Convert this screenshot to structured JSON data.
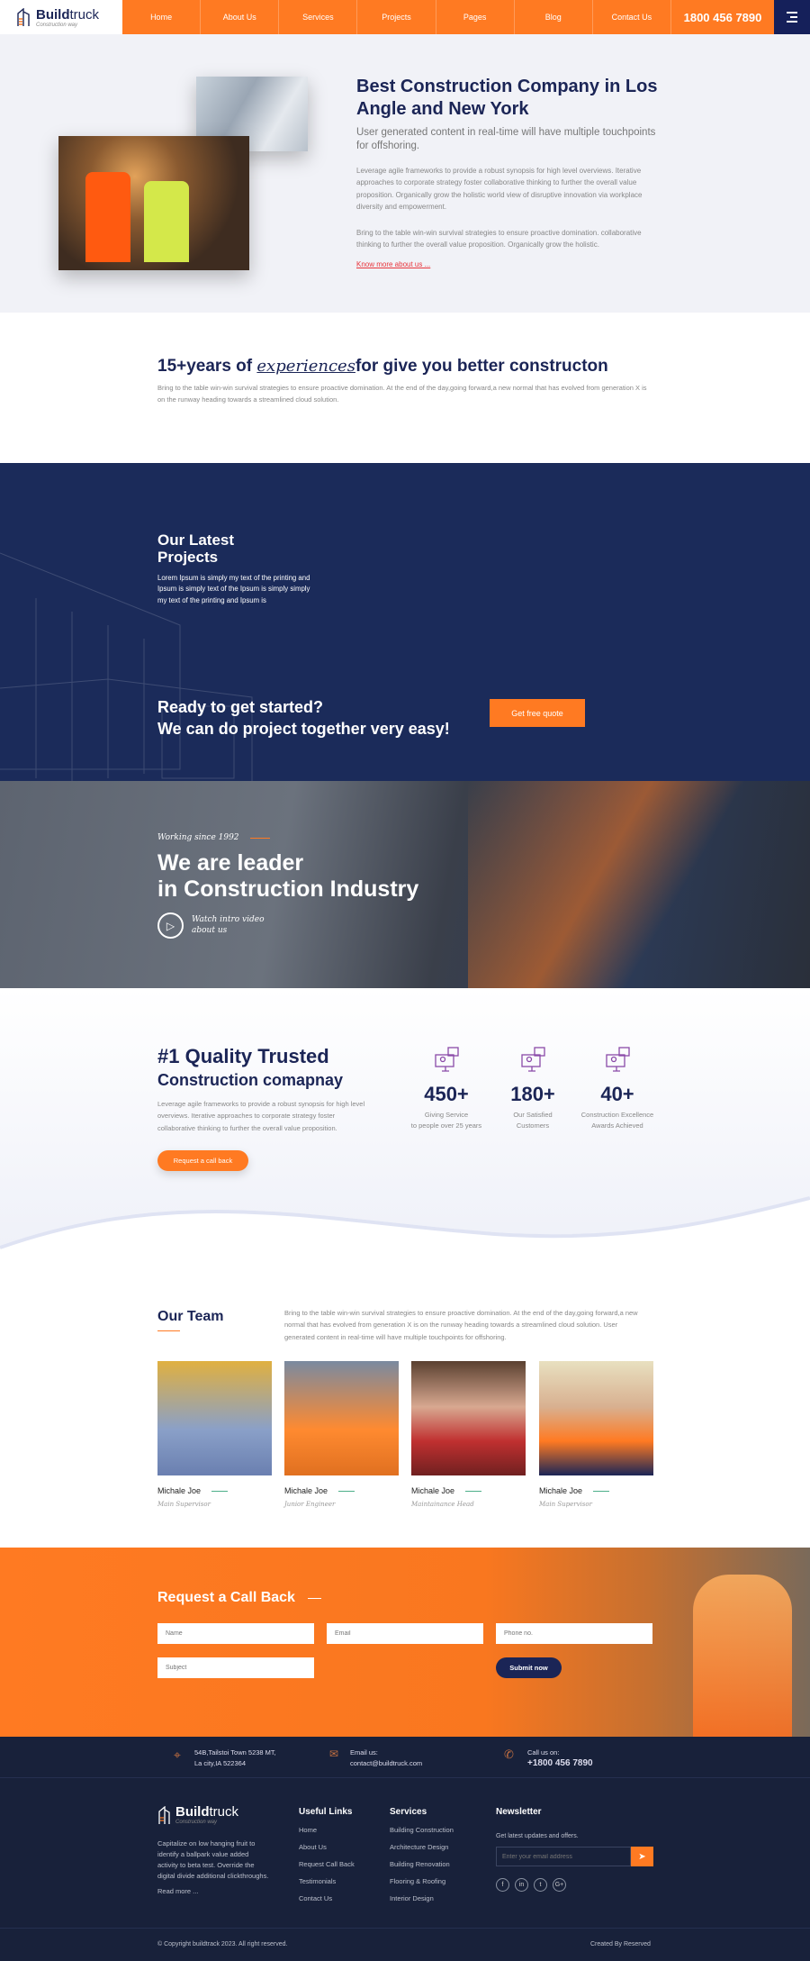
{
  "brand": {
    "name_bold": "Build",
    "name_light": "truck",
    "tagline": "Construction way"
  },
  "nav": {
    "items": [
      "Home",
      "About Us",
      "Services",
      "Projects",
      "Pages",
      "Blog",
      "Contact Us"
    ],
    "phone": "1800 456 7890",
    "accent": "#ff7a22",
    "navy": "#1b2556"
  },
  "hero": {
    "title": "Best Construction Company in Los Angle and New York",
    "subtitle": "User generated content in real-time will have multiple touchpoints for offshoring.",
    "p1": "Leverage agile frameworks to provide a robust synopsis for high level overviews. Iterative approaches to corporate strategy foster collaborative thinking to further the overall value proposition. Organically grow the holistic world view of disruptive innovation via workplace diversity and empowerment.",
    "p2": "Bring to the table win-win survival strategies to ensure proactive domination. collaborative thinking to further the overall value proposition. Organically grow the holistic.",
    "link": "Know more about us ..."
  },
  "experience": {
    "title_pre": "15+years of ",
    "title_em": "experiences",
    "title_post": "for give you better constructon",
    "text": "Bring to the table win-win survival strategies to ensure proactive domination. At the end of the day,going forward,a new normal that has evolved from generation X is on the runway heading towards a streamlined cloud solution."
  },
  "projects": {
    "title_1": "Our Latest",
    "title_2": "Projects",
    "text": "Lorem Ipsum is simply my text of the printing and Ipsum is simply text of the Ipsum is simply simply my text of the printing and Ipsum is",
    "cta_1": "Ready to get started?",
    "cta_2": "We can do project together very easy!",
    "button": "Get free quote"
  },
  "leader": {
    "kicker": "Working since 1992",
    "title_1": "We are leader",
    "title_2": "in Construction Industry",
    "video_1": "Watch intro video",
    "video_2": "about us"
  },
  "quality": {
    "title_1": "#1 Quality Trusted",
    "title_2": "Construction comapnay",
    "text": "Leverage agile frameworks to provide a robust synopsis for high level overviews. Iterative approaches to corporate strategy foster collaborative thinking to further the overall value proposition.",
    "button": "Request a call back",
    "stats": [
      {
        "icon": "consultant-monitor-icon",
        "value": "450+",
        "l1": "Giving Service",
        "l2": "to people over 25 years"
      },
      {
        "icon": "consultant-monitor-icon",
        "value": "180+",
        "l1": "Our Satisfied",
        "l2": "Customers"
      },
      {
        "icon": "consultant-monitor-icon",
        "value": "40+",
        "l1": "Construction Excellence",
        "l2": "Awards Achieved"
      }
    ]
  },
  "team": {
    "title": "Our Team",
    "text": "Bring to the table win-win survival strategies to ensure proactive domination. At the end of the day,going forward,a new normal that has evolved from generation X is on the runway heading towards a streamlined cloud solution. User generated content in real-time will have multiple touchpoints for offshoring.",
    "members": [
      {
        "name": "Michale Joe",
        "role": "Main Supervisor"
      },
      {
        "name": "Michale Joe",
        "role": "Junior Engineer"
      },
      {
        "name": "Michale Joe",
        "role": "Maintainance Head"
      },
      {
        "name": "Michale Joe",
        "role": "Main Supervisor"
      }
    ]
  },
  "callback": {
    "title": "Request a Call Back",
    "name_ph": "Name",
    "email_ph": "Email",
    "phone_ph": "Phone no.",
    "subject_ph": "Subject",
    "submit": "Submit now"
  },
  "contact": {
    "addr_1": "54B,Tailstoi Town 5238 MT,",
    "addr_2": "La city,IA 522364",
    "email_label": "Email us:",
    "email": "contact@buildtruck.com",
    "call_label": "Call us on:",
    "call": "+1800 456 7890"
  },
  "footer": {
    "about": "Capitalize on low hanging fruit to identify a ballpark value added activity to beta test. Override the digital divide additional clickthroughs.",
    "read_more": "Read more ...",
    "useful_title": "Useful Links",
    "useful": [
      "Home",
      "About Us",
      "Request Call Back",
      "Testimonials",
      "Contact Us"
    ],
    "services_title": "Services",
    "services": [
      "Building Construction",
      "Architecture Design",
      "Building Renovation",
      "Flooring & Roofing",
      "Interior Design"
    ],
    "newsletter_title": "Newsletter",
    "newsletter_text": "Get latest updates and offers.",
    "newsletter_ph": "Enter your email address",
    "social": [
      "f",
      "in",
      "t",
      "G+"
    ],
    "copyright": "© Copyright buildtrack 2023. All right reserved.",
    "credit": "Created By Reserved"
  }
}
